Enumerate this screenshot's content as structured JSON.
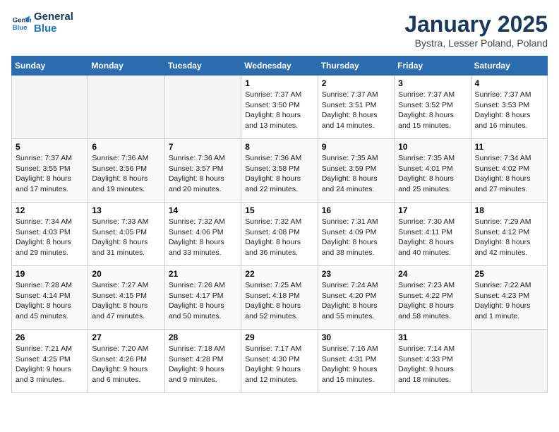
{
  "logo": {
    "line1": "General",
    "line2": "Blue"
  },
  "calendar": {
    "title": "January 2025",
    "subtitle": "Bystra, Lesser Poland, Poland",
    "headers": [
      "Sunday",
      "Monday",
      "Tuesday",
      "Wednesday",
      "Thursday",
      "Friday",
      "Saturday"
    ],
    "weeks": [
      [
        {
          "day": "",
          "info": ""
        },
        {
          "day": "",
          "info": ""
        },
        {
          "day": "",
          "info": ""
        },
        {
          "day": "1",
          "info": "Sunrise: 7:37 AM\nSunset: 3:50 PM\nDaylight: 8 hours\nand 13 minutes."
        },
        {
          "day": "2",
          "info": "Sunrise: 7:37 AM\nSunset: 3:51 PM\nDaylight: 8 hours\nand 14 minutes."
        },
        {
          "day": "3",
          "info": "Sunrise: 7:37 AM\nSunset: 3:52 PM\nDaylight: 8 hours\nand 15 minutes."
        },
        {
          "day": "4",
          "info": "Sunrise: 7:37 AM\nSunset: 3:53 PM\nDaylight: 8 hours\nand 16 minutes."
        }
      ],
      [
        {
          "day": "5",
          "info": "Sunrise: 7:37 AM\nSunset: 3:55 PM\nDaylight: 8 hours\nand 17 minutes."
        },
        {
          "day": "6",
          "info": "Sunrise: 7:36 AM\nSunset: 3:56 PM\nDaylight: 8 hours\nand 19 minutes."
        },
        {
          "day": "7",
          "info": "Sunrise: 7:36 AM\nSunset: 3:57 PM\nDaylight: 8 hours\nand 20 minutes."
        },
        {
          "day": "8",
          "info": "Sunrise: 7:36 AM\nSunset: 3:58 PM\nDaylight: 8 hours\nand 22 minutes."
        },
        {
          "day": "9",
          "info": "Sunrise: 7:35 AM\nSunset: 3:59 PM\nDaylight: 8 hours\nand 24 minutes."
        },
        {
          "day": "10",
          "info": "Sunrise: 7:35 AM\nSunset: 4:01 PM\nDaylight: 8 hours\nand 25 minutes."
        },
        {
          "day": "11",
          "info": "Sunrise: 7:34 AM\nSunset: 4:02 PM\nDaylight: 8 hours\nand 27 minutes."
        }
      ],
      [
        {
          "day": "12",
          "info": "Sunrise: 7:34 AM\nSunset: 4:03 PM\nDaylight: 8 hours\nand 29 minutes."
        },
        {
          "day": "13",
          "info": "Sunrise: 7:33 AM\nSunset: 4:05 PM\nDaylight: 8 hours\nand 31 minutes."
        },
        {
          "day": "14",
          "info": "Sunrise: 7:32 AM\nSunset: 4:06 PM\nDaylight: 8 hours\nand 33 minutes."
        },
        {
          "day": "15",
          "info": "Sunrise: 7:32 AM\nSunset: 4:08 PM\nDaylight: 8 hours\nand 36 minutes."
        },
        {
          "day": "16",
          "info": "Sunrise: 7:31 AM\nSunset: 4:09 PM\nDaylight: 8 hours\nand 38 minutes."
        },
        {
          "day": "17",
          "info": "Sunrise: 7:30 AM\nSunset: 4:11 PM\nDaylight: 8 hours\nand 40 minutes."
        },
        {
          "day": "18",
          "info": "Sunrise: 7:29 AM\nSunset: 4:12 PM\nDaylight: 8 hours\nand 42 minutes."
        }
      ],
      [
        {
          "day": "19",
          "info": "Sunrise: 7:28 AM\nSunset: 4:14 PM\nDaylight: 8 hours\nand 45 minutes."
        },
        {
          "day": "20",
          "info": "Sunrise: 7:27 AM\nSunset: 4:15 PM\nDaylight: 8 hours\nand 47 minutes."
        },
        {
          "day": "21",
          "info": "Sunrise: 7:26 AM\nSunset: 4:17 PM\nDaylight: 8 hours\nand 50 minutes."
        },
        {
          "day": "22",
          "info": "Sunrise: 7:25 AM\nSunset: 4:18 PM\nDaylight: 8 hours\nand 52 minutes."
        },
        {
          "day": "23",
          "info": "Sunrise: 7:24 AM\nSunset: 4:20 PM\nDaylight: 8 hours\nand 55 minutes."
        },
        {
          "day": "24",
          "info": "Sunrise: 7:23 AM\nSunset: 4:22 PM\nDaylight: 8 hours\nand 58 minutes."
        },
        {
          "day": "25",
          "info": "Sunrise: 7:22 AM\nSunset: 4:23 PM\nDaylight: 9 hours\nand 1 minute."
        }
      ],
      [
        {
          "day": "26",
          "info": "Sunrise: 7:21 AM\nSunset: 4:25 PM\nDaylight: 9 hours\nand 3 minutes."
        },
        {
          "day": "27",
          "info": "Sunrise: 7:20 AM\nSunset: 4:26 PM\nDaylight: 9 hours\nand 6 minutes."
        },
        {
          "day": "28",
          "info": "Sunrise: 7:18 AM\nSunset: 4:28 PM\nDaylight: 9 hours\nand 9 minutes."
        },
        {
          "day": "29",
          "info": "Sunrise: 7:17 AM\nSunset: 4:30 PM\nDaylight: 9 hours\nand 12 minutes."
        },
        {
          "day": "30",
          "info": "Sunrise: 7:16 AM\nSunset: 4:31 PM\nDaylight: 9 hours\nand 15 minutes."
        },
        {
          "day": "31",
          "info": "Sunrise: 7:14 AM\nSunset: 4:33 PM\nDaylight: 9 hours\nand 18 minutes."
        },
        {
          "day": "",
          "info": ""
        }
      ]
    ]
  }
}
